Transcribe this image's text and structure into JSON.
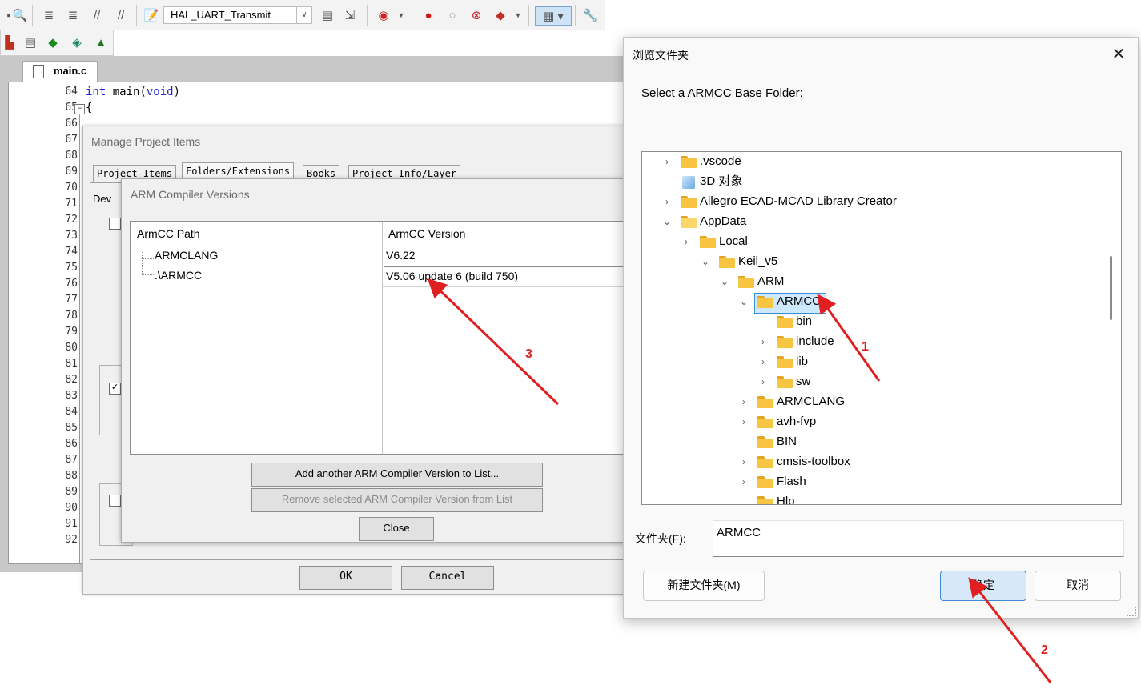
{
  "ide": {
    "target_name": "HAL_UART_Transmit",
    "editor_tab": "main.c",
    "line_numbers": [
      "64",
      "65",
      "66",
      "67",
      "68",
      "69",
      "70",
      "71",
      "72",
      "73",
      "74",
      "75",
      "76",
      "77",
      "78",
      "79",
      "80",
      "81",
      "82",
      "83",
      "84",
      "85",
      "86",
      "87",
      "88",
      "89",
      "90",
      "91",
      "92"
    ],
    "code_line_64_keyword": "int",
    "code_line_64_rest": " main(",
    "code_line_64_param": "void",
    "code_line_64_close": ")",
    "code_line_65": "{",
    "toolbar_icons": [
      "find-icon",
      "indent-icon",
      "unindent-icon",
      "comment-icon",
      "uncomment-icon",
      "target-options-icon",
      "load-icon",
      "download-icon",
      "debug-icon",
      "breakpoint-icon",
      "breakpoint-disable-icon",
      "breakpoint-kill-icon",
      "stop-icon",
      "window-layout-icon",
      "wrench-icon"
    ]
  },
  "manage_project_items": {
    "title": "Manage Project Items",
    "tabs": [
      "Project Items",
      "Folders/Extensions",
      "Books",
      "Project Info/Layer"
    ],
    "device_label_partial": "Dev",
    "ok_label": "OK",
    "cancel_label": "Cancel"
  },
  "arm_compiler_versions": {
    "title": "ARM Compiler Versions",
    "col_path": "ArmCC Path",
    "col_version": "ArmCC Version",
    "rows": [
      {
        "path": "ARMCLANG",
        "version": "V6.22"
      },
      {
        "path": ".\\ARMCC",
        "version": "V5.06 update 6 (build 750)"
      }
    ],
    "add_button": "Add another ARM Compiler Version to List...",
    "remove_button": "Remove selected ARM Compiler Version from List",
    "close_button": "Close"
  },
  "browse_folder": {
    "title": "浏览文件夹",
    "prompt": "Select a ARMCC Base Folder:",
    "tree": [
      {
        "label": ".vscode",
        "chevron": "›"
      },
      {
        "label": "3D 对象",
        "chevron": ""
      },
      {
        "label": "Allegro ECAD-MCAD Library Creator",
        "chevron": "›"
      },
      {
        "label": "AppData",
        "chevron": "⌄"
      },
      {
        "label": "Local",
        "chevron": "›"
      },
      {
        "label": "Keil_v5",
        "chevron": "⌄"
      },
      {
        "label": "ARM",
        "chevron": "⌄"
      },
      {
        "label": "ARMCC",
        "chevron": "⌄"
      },
      {
        "label": "bin",
        "chevron": ""
      },
      {
        "label": "include",
        "chevron": "›"
      },
      {
        "label": "lib",
        "chevron": "›"
      },
      {
        "label": "sw",
        "chevron": "›"
      },
      {
        "label": "ARMCLANG",
        "chevron": "›"
      },
      {
        "label": "avh-fvp",
        "chevron": "›"
      },
      {
        "label": "BIN",
        "chevron": ""
      },
      {
        "label": "cmsis-toolbox",
        "chevron": "›"
      },
      {
        "label": "Flash",
        "chevron": "›"
      },
      {
        "label": "Hlp",
        "chevron": ""
      }
    ],
    "folder_label": "文件夹(F):",
    "folder_value": "ARMCC",
    "new_folder_button": "新建文件夹(M)",
    "ok_button": "确定",
    "cancel_button": "取消"
  },
  "annotations": {
    "step1": "1",
    "step2": "2",
    "step3": "3",
    "arrow_color": "#e02020"
  }
}
